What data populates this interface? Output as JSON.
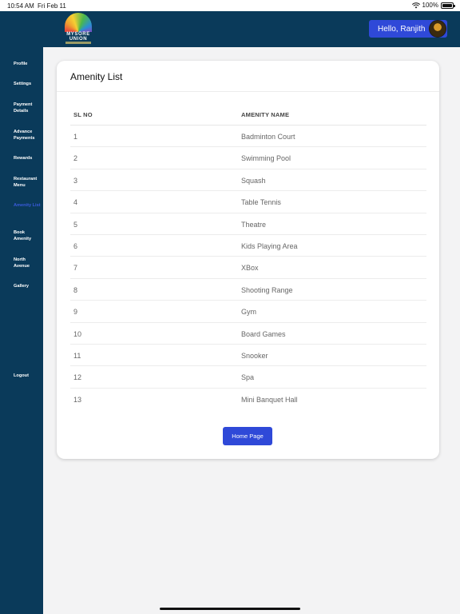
{
  "status_bar": {
    "time": "10:54 AM",
    "date": "Fri Feb 11",
    "battery": "100%"
  },
  "header": {
    "logo_text": "MYSORE\nUNION",
    "greeting": "Hello, Ranjith"
  },
  "sidebar": {
    "items": [
      {
        "label": "Profile"
      },
      {
        "label": "Settings"
      },
      {
        "label": "Payment Details"
      },
      {
        "label": "Advance Payments"
      },
      {
        "label": "Rewards"
      },
      {
        "label": "Restaurant Menu"
      },
      {
        "label": "Amenity List",
        "active": true
      },
      {
        "label": "Book Amenity"
      },
      {
        "label": "North Avenue"
      },
      {
        "label": "Gallery"
      },
      {
        "label": "Logout"
      }
    ]
  },
  "card": {
    "title": "Amenity List",
    "columns": {
      "sl": "SL NO",
      "name": "AMENITY NAME"
    },
    "rows": [
      {
        "sl": "1",
        "name": "Badminton Court"
      },
      {
        "sl": "2",
        "name": "Swimming Pool"
      },
      {
        "sl": "3",
        "name": "Squash"
      },
      {
        "sl": "4",
        "name": "Table Tennis"
      },
      {
        "sl": "5",
        "name": "Theatre"
      },
      {
        "sl": "6",
        "name": "Kids Playing Area"
      },
      {
        "sl": "7",
        "name": "XBox"
      },
      {
        "sl": "8",
        "name": "Shooting Range"
      },
      {
        "sl": "9",
        "name": "Gym"
      },
      {
        "sl": "10",
        "name": "Board Games"
      },
      {
        "sl": "11",
        "name": "Snooker"
      },
      {
        "sl": "12",
        "name": "Spa"
      },
      {
        "sl": "13",
        "name": "Mini Banquet Hall"
      }
    ],
    "home_button": "Home Page"
  },
  "colors": {
    "header_bg": "#0a3a5a",
    "accent": "#2f49d8",
    "active_nav": "#3a5bdc"
  },
  "icons": {
    "wifi": "wifi-icon",
    "battery": "battery-icon",
    "avatar": "avatar"
  }
}
